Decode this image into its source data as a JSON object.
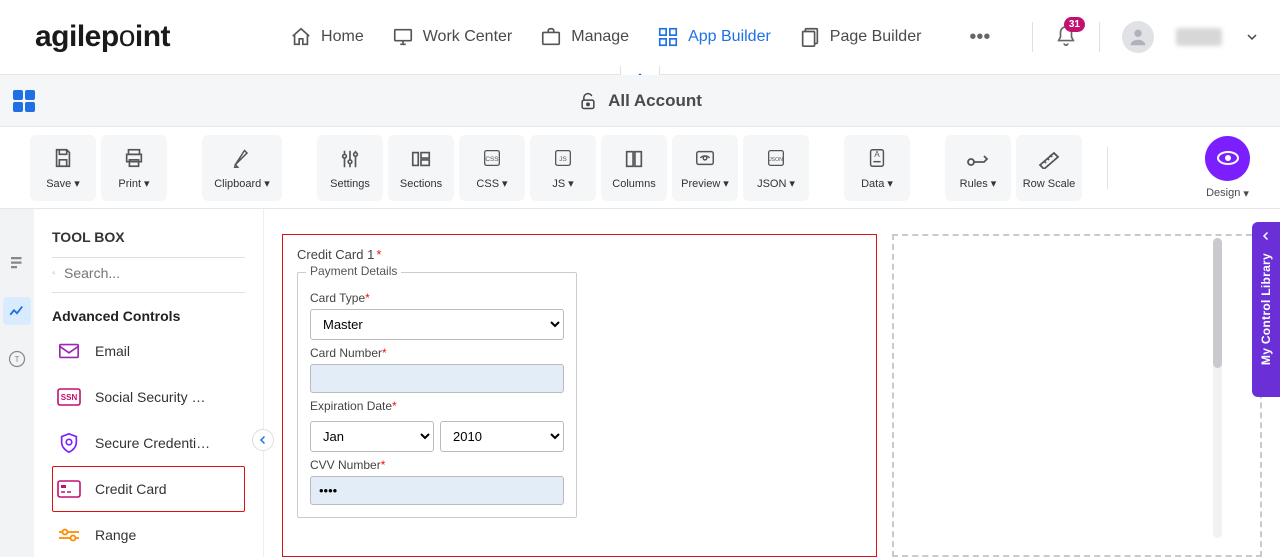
{
  "nav": {
    "home": "Home",
    "work_center": "Work Center",
    "manage": "Manage",
    "app_builder": "App Builder",
    "page_builder": "Page Builder"
  },
  "notifications": {
    "count": "31"
  },
  "account_bar": {
    "title": "All Account"
  },
  "ribbon": {
    "save": "Save",
    "print": "Print",
    "clipboard": "Clipboard",
    "settings": "Settings",
    "sections": "Sections",
    "css": "CSS",
    "js": "JS",
    "columns": "Columns",
    "preview": "Preview",
    "json": "JSON",
    "data": "Data",
    "rules": "Rules",
    "row_scale": "Row Scale",
    "design": "Design"
  },
  "toolbox": {
    "title": "TOOL BOX",
    "search_placeholder": "Search...",
    "section": "Advanced Controls",
    "items": {
      "email": "Email",
      "ssn": "Social Security …",
      "secure": "Secure Credenti…",
      "credit_card": "Credit Card",
      "range": "Range"
    }
  },
  "form": {
    "block_title": "Credit Card 1",
    "legend": "Payment Details",
    "card_type_label": "Card Type",
    "card_type_value": "Master",
    "card_number_label": "Card Number",
    "card_number_value": "",
    "exp_label": "Expiration Date",
    "exp_month": "Jan",
    "exp_year": "2010",
    "cvv_label": "CVV Number",
    "cvv_value": "••••"
  },
  "side_panel": {
    "label": "My Control Library"
  }
}
